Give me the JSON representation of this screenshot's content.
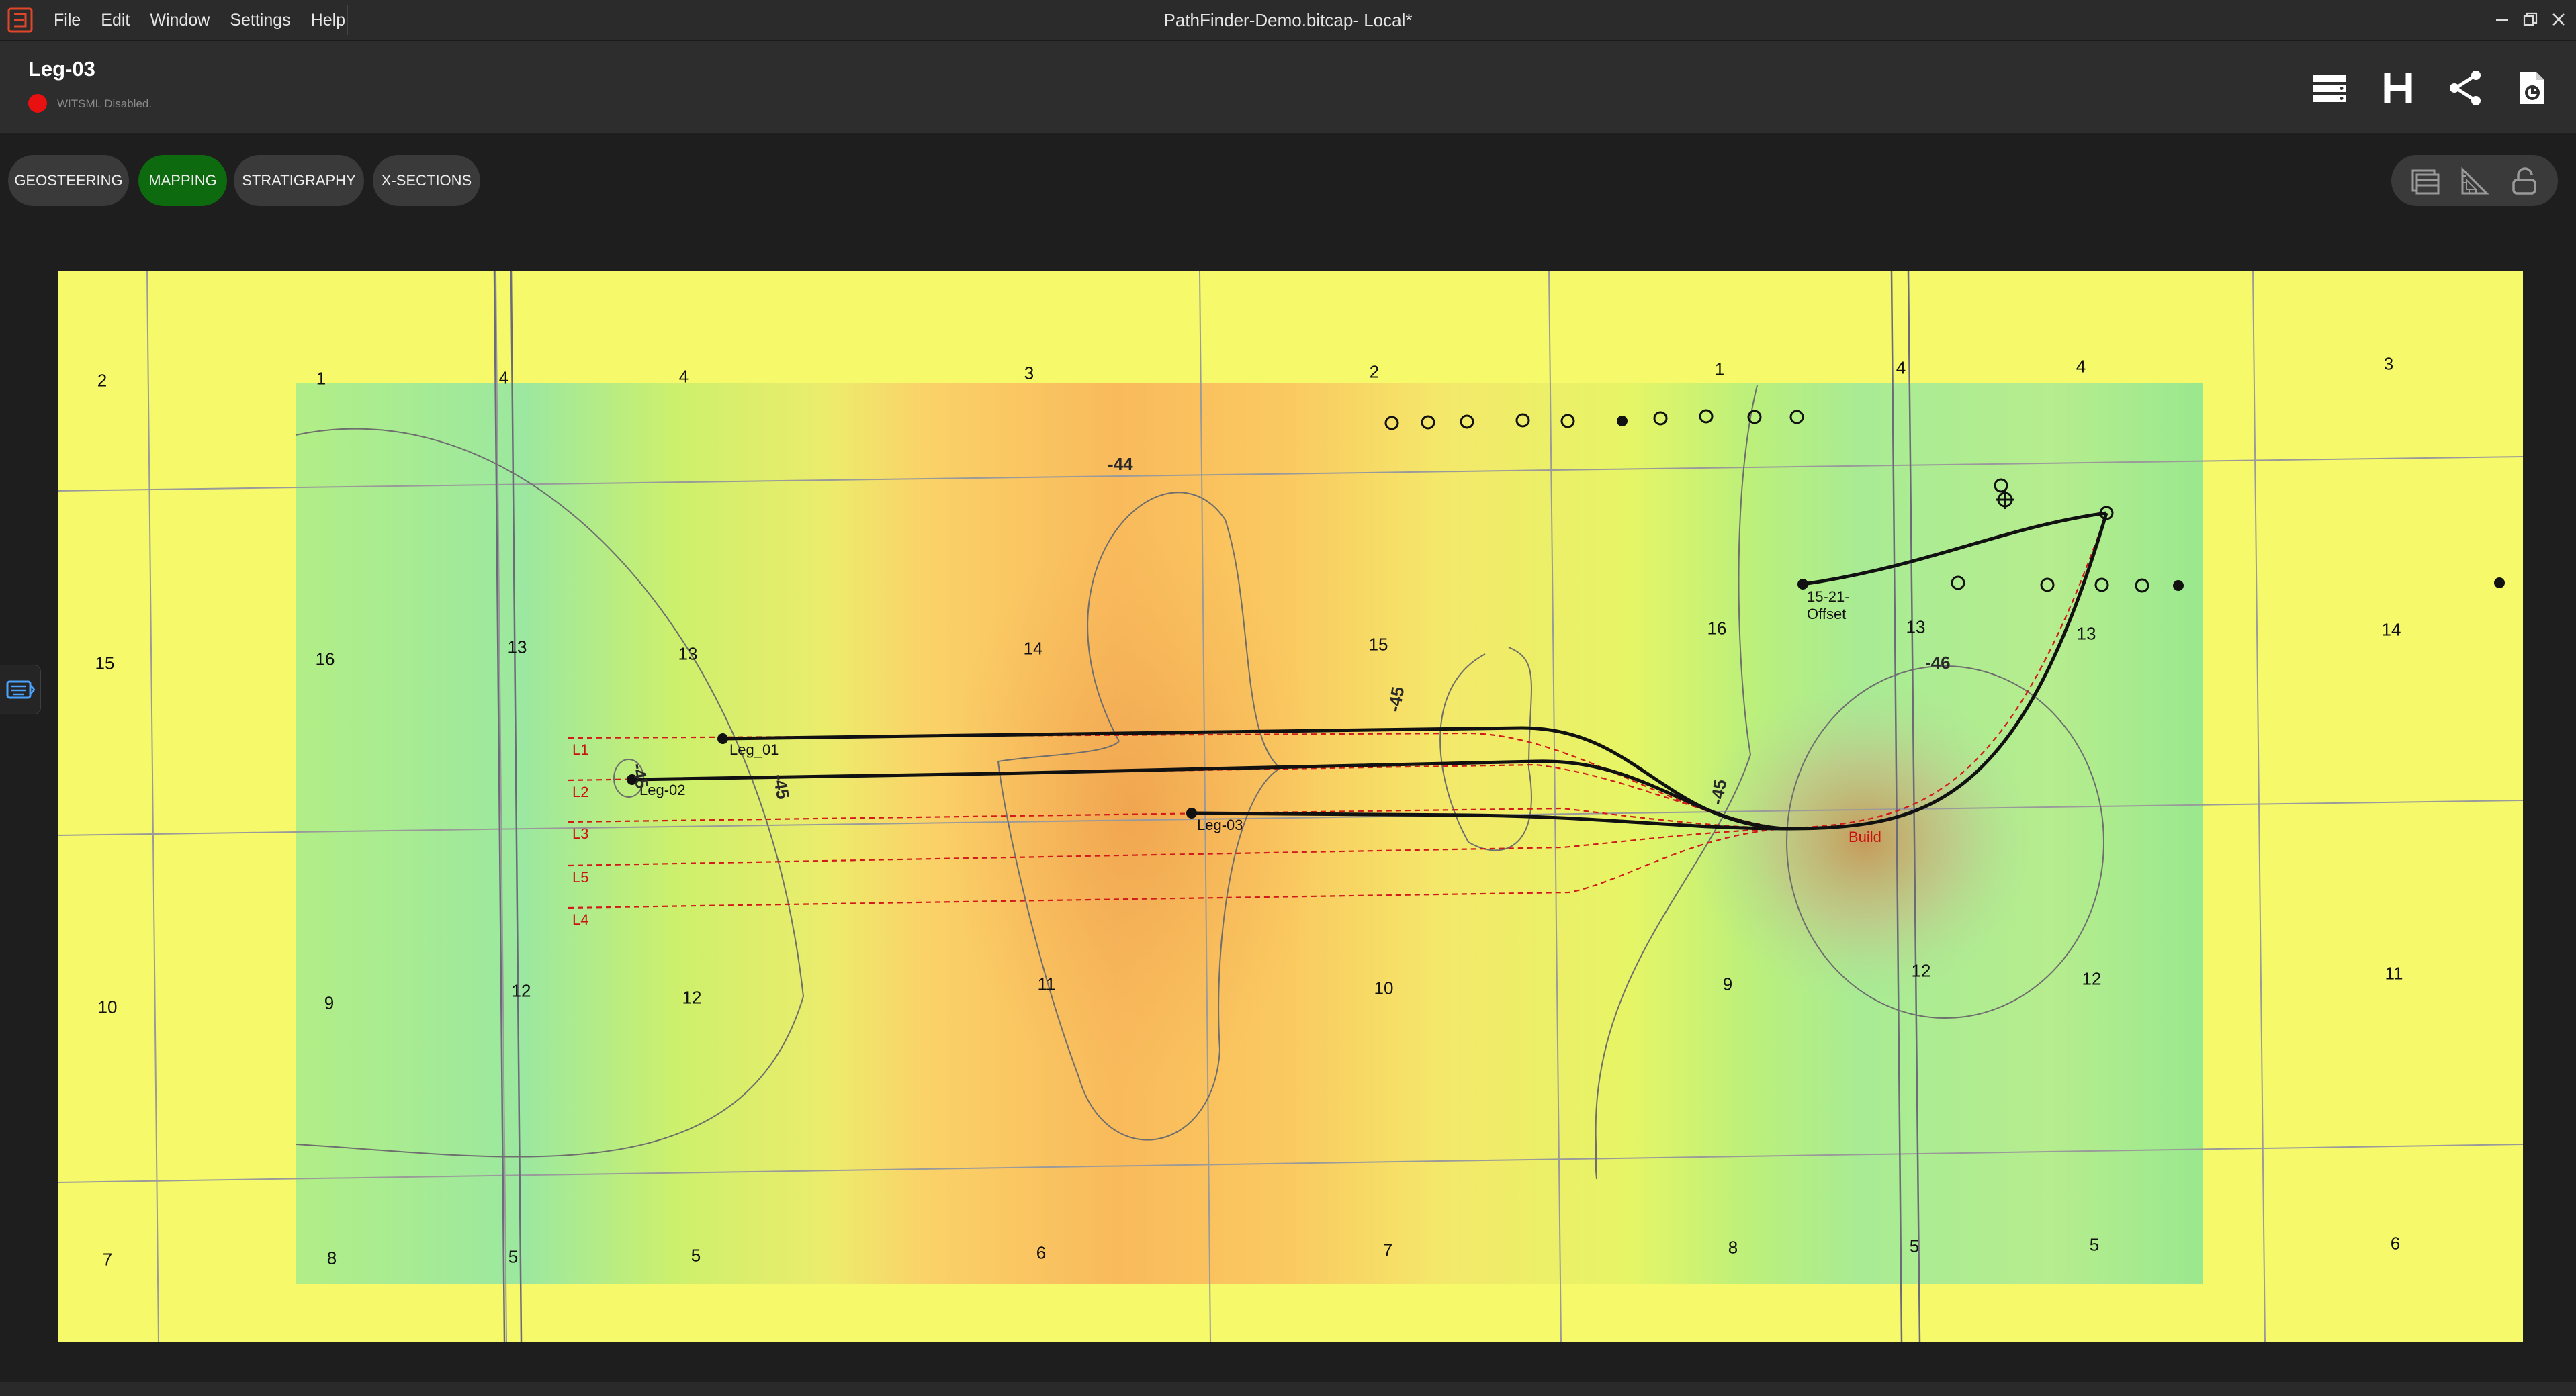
{
  "window": {
    "title": "PathFinder-Demo.bitcap- Local*",
    "menu": [
      "File",
      "Edit",
      "Window",
      "Settings",
      "Help"
    ]
  },
  "header": {
    "well_name": "Leg-03",
    "witsml_status": "WITSML Disabled.",
    "status_color": "#e81010",
    "icons": [
      "server-stack-icon",
      "h-icon",
      "share-icon",
      "report-icon"
    ]
  },
  "tabs": [
    {
      "label": "GEOSTEERING",
      "active": false
    },
    {
      "label": "MAPPING",
      "active": true
    },
    {
      "label": "STRATIGRAPHY",
      "active": false
    },
    {
      "label": "X-SECTIONS",
      "active": false
    }
  ],
  "map_tools": [
    "layers-icon",
    "ruler-triangle-icon",
    "lock-icon"
  ],
  "colors": {
    "accent_active": "#0e6a0e",
    "background": "#1e1e1e",
    "map_base": "#f6fa6a"
  },
  "map": {
    "sections": [
      "2",
      "1",
      "4",
      "4",
      "3",
      "2",
      "1",
      "4",
      "4",
      "3",
      "15",
      "16",
      "13",
      "13",
      "14",
      "15",
      "16",
      "13",
      "13",
      "14",
      "10",
      "9",
      "12",
      "12",
      "11",
      "10",
      "9",
      "12",
      "12",
      "11",
      "7",
      "8",
      "5",
      "5",
      "6",
      "7",
      "8",
      "5",
      "5",
      "6"
    ],
    "wells": [
      "Leg_01",
      "Leg-02",
      "Leg-03",
      "15-21-",
      "Offset"
    ],
    "laterals": [
      "L1",
      "L2",
      "L3",
      "L5",
      "L4"
    ],
    "build_label": "Build",
    "contours": [
      "-44",
      "-45",
      "-45",
      "-45",
      "-45",
      "-46"
    ]
  }
}
